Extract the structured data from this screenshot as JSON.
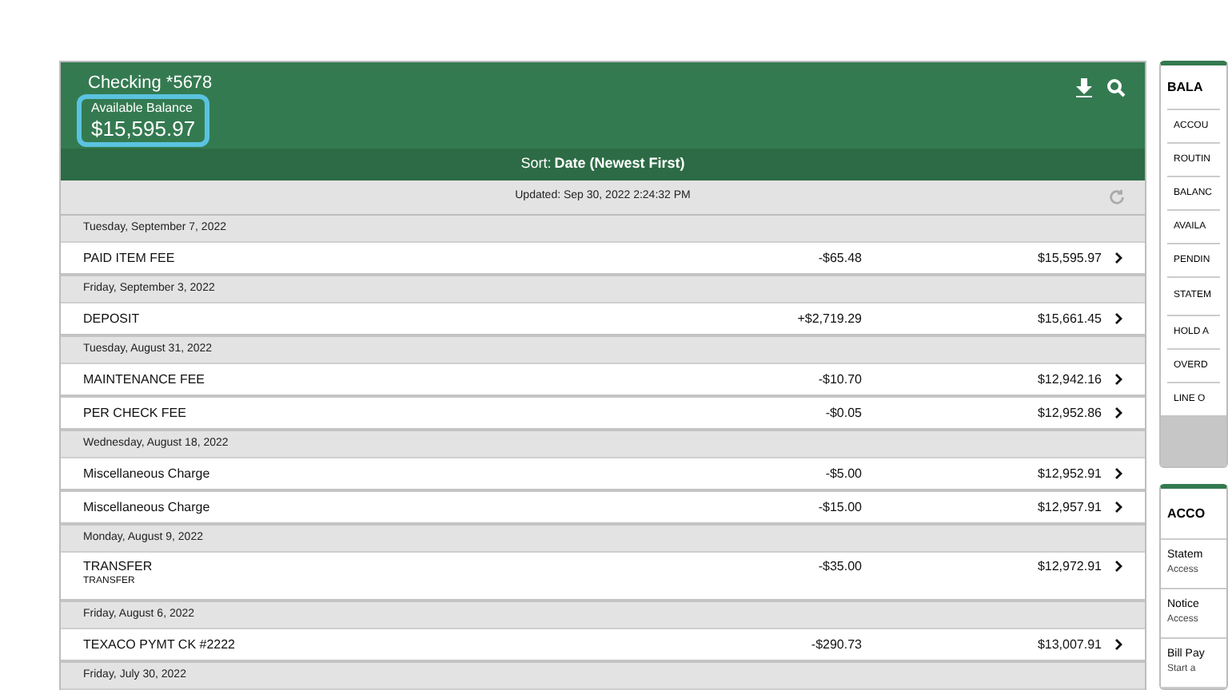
{
  "account": {
    "name": "Checking *5678",
    "balance_label": "Available Balance",
    "balance": "$15,595.97"
  },
  "sort": {
    "label": "Sort:",
    "value": "Date (Newest First)"
  },
  "updated": "Updated: Sep 30, 2022 2:24:32 PM",
  "groups": [
    {
      "date": "Tuesday, September 7, 2022",
      "transactions": [
        {
          "description": "PAID ITEM FEE",
          "amount": "-$65.48",
          "balance": "$15,595.97"
        }
      ]
    },
    {
      "date": "Friday, September 3, 2022",
      "transactions": [
        {
          "description": "DEPOSIT",
          "amount": "+$2,719.29",
          "balance": "$15,661.45"
        }
      ]
    },
    {
      "date": "Tuesday, August 31, 2022",
      "transactions": [
        {
          "description": "MAINTENANCE FEE",
          "amount": "-$10.70",
          "balance": "$12,942.16"
        },
        {
          "description": "PER CHECK FEE",
          "amount": "-$0.05",
          "balance": "$12,952.86"
        }
      ]
    },
    {
      "date": "Wednesday, August 18, 2022",
      "transactions": [
        {
          "description": "Miscellaneous Charge",
          "amount": "-$5.00",
          "balance": "$12,952.91"
        },
        {
          "description": "Miscellaneous Charge",
          "amount": "-$15.00",
          "balance": "$12,957.91"
        }
      ]
    },
    {
      "date": "Monday, August 9, 2022",
      "transactions": [
        {
          "description": "TRANSFER",
          "memo": "TRANSFER",
          "amount": "-$35.00",
          "balance": "$12,972.91"
        }
      ]
    },
    {
      "date": "Friday, August 6, 2022",
      "transactions": [
        {
          "description": "TEXACO PYMT CK #2222",
          "amount": "-$290.73",
          "balance": "$13,007.91"
        }
      ]
    },
    {
      "date": "Friday, July 30, 2022"
    }
  ],
  "balance_card": {
    "title": "BALA",
    "rows": [
      "ACCOU",
      "ROUTIN",
      "BALANC",
      "AVAILA",
      "PENDIN",
      "STATEM",
      "HOLD A",
      "OVERD",
      "LINE O"
    ]
  },
  "accounts_card": {
    "title": "ACCO",
    "items": [
      {
        "title": "Statem",
        "subtitle": "Access"
      },
      {
        "title": "Notice",
        "subtitle": "Access"
      },
      {
        "title": "Bill Pay",
        "subtitle": "Start a"
      }
    ]
  }
}
